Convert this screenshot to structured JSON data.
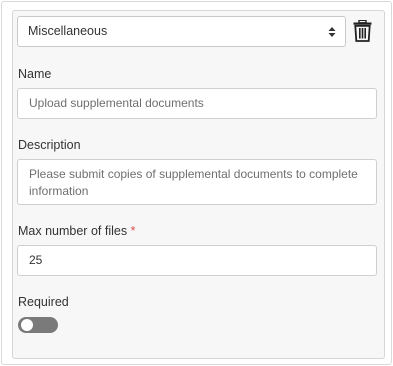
{
  "category": {
    "selected": "Miscellaneous",
    "arrow_icon": "up-down-caret-icon",
    "delete_icon": "trash-icon"
  },
  "name": {
    "label": "Name",
    "placeholder": "Upload supplemental documents"
  },
  "description": {
    "label": "Description",
    "placeholder": "Please submit copies of supplemental documents to complete information"
  },
  "max_files": {
    "label": "Max number of files",
    "required_marker": "*",
    "value": "25"
  },
  "required": {
    "label": "Required",
    "enabled": false
  },
  "colors": {
    "panel_bg": "#f7f7f7",
    "toggle_off": "#7a7a7a",
    "required_star": "#d9534f"
  }
}
